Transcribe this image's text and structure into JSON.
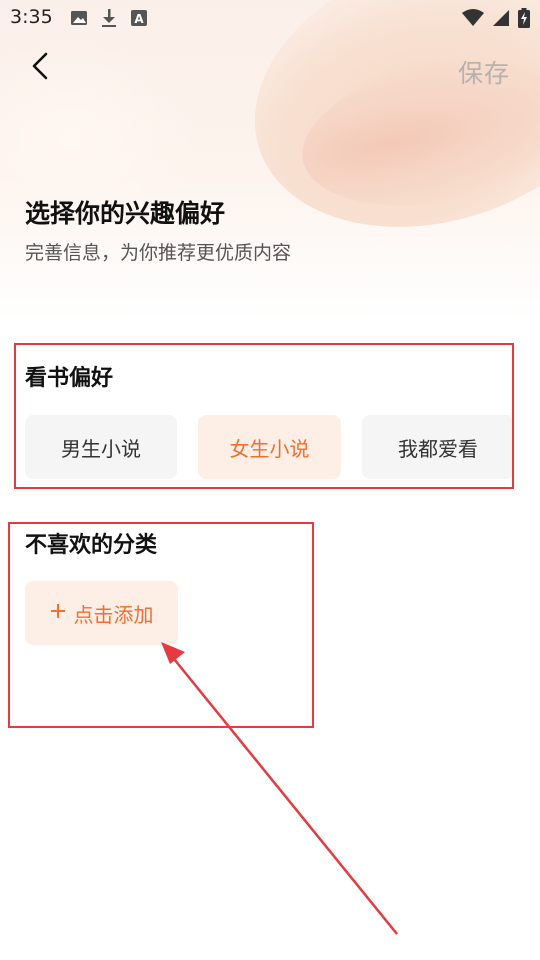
{
  "status_bar": {
    "time": "3:35",
    "left_icons": [
      "image-icon",
      "download-icon",
      "font-icon"
    ],
    "right_icons": [
      "wifi-icon",
      "signal-icon",
      "battery-charging-icon"
    ]
  },
  "nav": {
    "back_icon": "chevron-left-icon",
    "save_label": "保存"
  },
  "header": {
    "title": "选择你的兴趣偏好",
    "subtitle": "完善信息，为你推荐更优质内容"
  },
  "reading_pref": {
    "title": "看书偏好",
    "options": [
      {
        "label": "男生小说",
        "selected": false
      },
      {
        "label": "女生小说",
        "selected": true
      },
      {
        "label": "我都爱看",
        "selected": false
      }
    ]
  },
  "disliked": {
    "title": "不喜欢的分类",
    "add_label": "点击添加",
    "add_icon": "plus-icon"
  },
  "colors": {
    "accent": "#f26f2f",
    "accent_bg": "#fdeee6",
    "annotation": "#e53a3f"
  }
}
